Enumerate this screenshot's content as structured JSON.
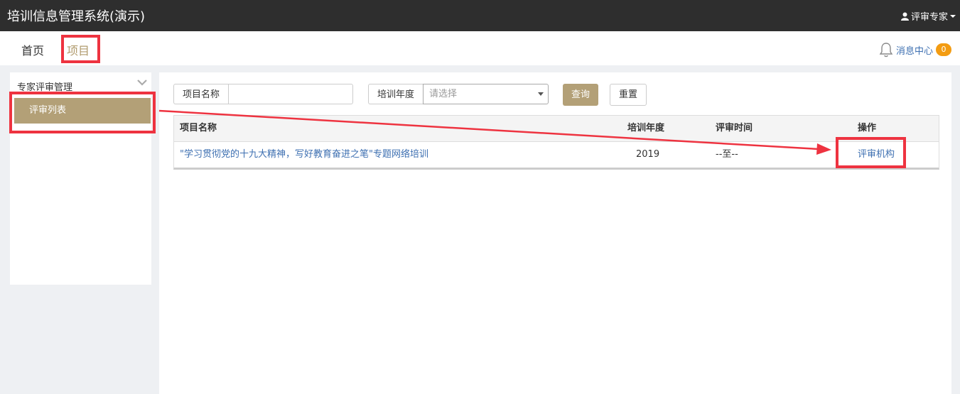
{
  "header": {
    "app_title": "培训信息管理系统(演示)",
    "user_label": "评审专家"
  },
  "nav": {
    "home": "首页",
    "project": "项目",
    "message_center": "消息中心",
    "message_count": "0"
  },
  "sidebar": {
    "group_title": "专家评审管理",
    "items": [
      {
        "label": "评审列表"
      }
    ]
  },
  "search": {
    "name_label": "项目名称",
    "name_value": "",
    "year_label": "培训年度",
    "year_placeholder": "请选择",
    "query_button": "查询",
    "reset_button": "重置"
  },
  "table": {
    "columns": [
      "项目名称",
      "培训年度",
      "评审时间",
      "操作"
    ],
    "rows": [
      {
        "name": "\"学习贯彻党的十九大精神，写好教育奋进之笔\"专题网络培训",
        "year": "2019",
        "time": "--至--",
        "action": "评审机构"
      }
    ]
  },
  "colors": {
    "accent": "#b3a077",
    "link": "#3d6fb1",
    "highlight": "#ee3340",
    "topbar": "#2e2e2e",
    "badge": "#f39c12"
  }
}
